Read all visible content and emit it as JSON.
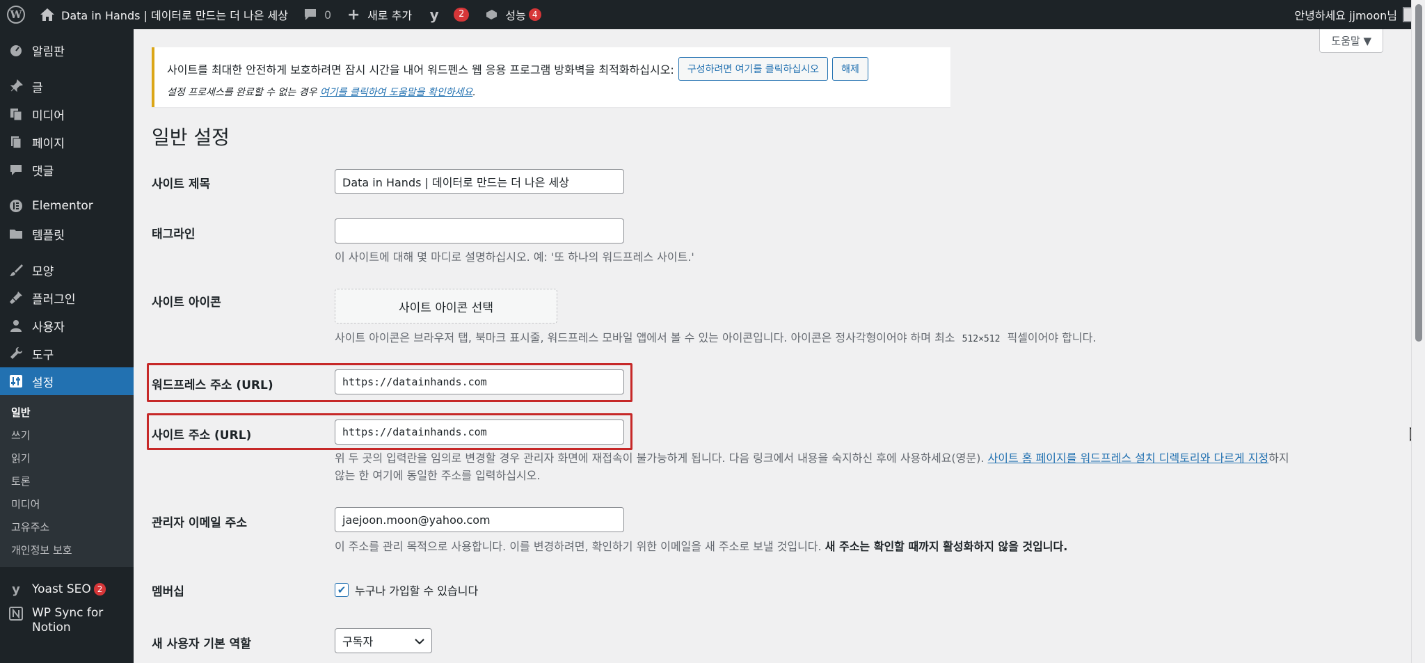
{
  "admin_bar": {
    "site_name": "Data in Hands | 데이터로 만드는 더 나은 세상",
    "comments_count": "0",
    "new_label": "새로 추가",
    "yoast_count": "2",
    "performance_label": "성능",
    "performance_count": "4",
    "greeting": "안녕하세요 jjmoon님"
  },
  "help_tab": "도움말 ▼",
  "sidebar": {
    "items": [
      {
        "label": "알림판",
        "icon": "dashboard-icon"
      },
      {
        "label": "글",
        "icon": "pin-icon"
      },
      {
        "label": "미디어",
        "icon": "media-icon"
      },
      {
        "label": "페이지",
        "icon": "page-icon"
      },
      {
        "label": "댓글",
        "icon": "comment-icon"
      },
      {
        "label": "Elementor",
        "icon": "elementor-icon"
      },
      {
        "label": "템플릿",
        "icon": "folder-icon"
      },
      {
        "label": "모양",
        "icon": "brush-icon"
      },
      {
        "label": "플러그인",
        "icon": "plugin-icon"
      },
      {
        "label": "사용자",
        "icon": "user-icon"
      },
      {
        "label": "도구",
        "icon": "wrench-icon"
      },
      {
        "label": "설정",
        "icon": "settings-icon"
      }
    ],
    "submenu": [
      "일반",
      "쓰기",
      "읽기",
      "토론",
      "미디어",
      "고유주소",
      "개인정보 보호"
    ],
    "yoast_label": "Yoast SEO",
    "yoast_count": "2",
    "wpsync_label_1": "WP Sync for",
    "wpsync_label_2": "Notion"
  },
  "notice": {
    "message": "사이트를 최대한 안전하게 보호하려면 잠시 시간을 내어 워드펜스 웹 응용 프로그램 방화벽을 최적화하십시오:",
    "configure_button": "구성하려면 여기를 클릭하십시오",
    "dismiss_button": "해제",
    "help_prefix": "설정 프로세스를 완료할 수 없는 경우 ",
    "help_link": "여기를 클릭하여 도움말을 확인하세요",
    "help_suffix": "."
  },
  "page_title": "일반 설정",
  "form": {
    "site_title_label": "사이트 제목",
    "site_title_value": "Data in Hands | 데이터로 만드는 더 나은 세상",
    "tagline_label": "태그라인",
    "tagline_value": "",
    "tagline_desc": "이 사이트에 대해 몇 마디로 설명하십시오. 예: '또 하나의 워드프레스 사이트.'",
    "site_icon_label": "사이트 아이콘",
    "site_icon_button": "사이트 아이콘 선택",
    "site_icon_desc_1": "사이트 아이콘은 브라우저 탭, 북마크 표시줄, 워드프레스 모바일 앱에서 볼 수 있는 아이콘입니다. 아이콘은 정사각형이어야 하며 최소 ",
    "site_icon_size": "512×512",
    "site_icon_desc_2": " 픽셀이어야 합니다.",
    "wp_address_label": "워드프레스 주소 (URL)",
    "wp_address_value": "https://datainhands.com",
    "site_address_label": "사이트 주소 (URL)",
    "site_address_value": "https://datainhands.com",
    "address_desc_1": "위 두 곳의 입력란을 임의로 변경할 경우 관리자 화면에 재접속이 불가능하게 됩니다. 다음 링크에서 내용을 숙지하신 후에 사용하세요(영문). ",
    "address_desc_link": "사이트 홈 페이지를 워드프레스 설치 디렉토리와 다르게 지정",
    "address_desc_2": "하지",
    "address_desc_3": "않는 한 여기에 동일한 주소를 입력하십시오.",
    "admin_email_label": "관리자 이메일 주소",
    "admin_email_value": "jaejoon.moon@yahoo.com",
    "admin_email_desc_1": "이 주소를 관리 목적으로 사용합니다. 이를 변경하려면, 확인하기 위한 이메일을 새 주소로 보낼 것입니다. ",
    "admin_email_desc_bold": "새 주소는 확인할 때까지 활성화하지 않을 것입니다.",
    "membership_label": "멤버십",
    "membership_checkbox": "누구나 가입할 수 있습니다",
    "membership_checked": true,
    "default_role_label": "새 사용자 기본 역할",
    "default_role_value": "구독자"
  },
  "colors": {
    "admin_bar": "#1d2327",
    "accent": "#2271b1",
    "highlight_box": "#c62828",
    "notice_border": "#dba617",
    "badge": "#d63638"
  }
}
